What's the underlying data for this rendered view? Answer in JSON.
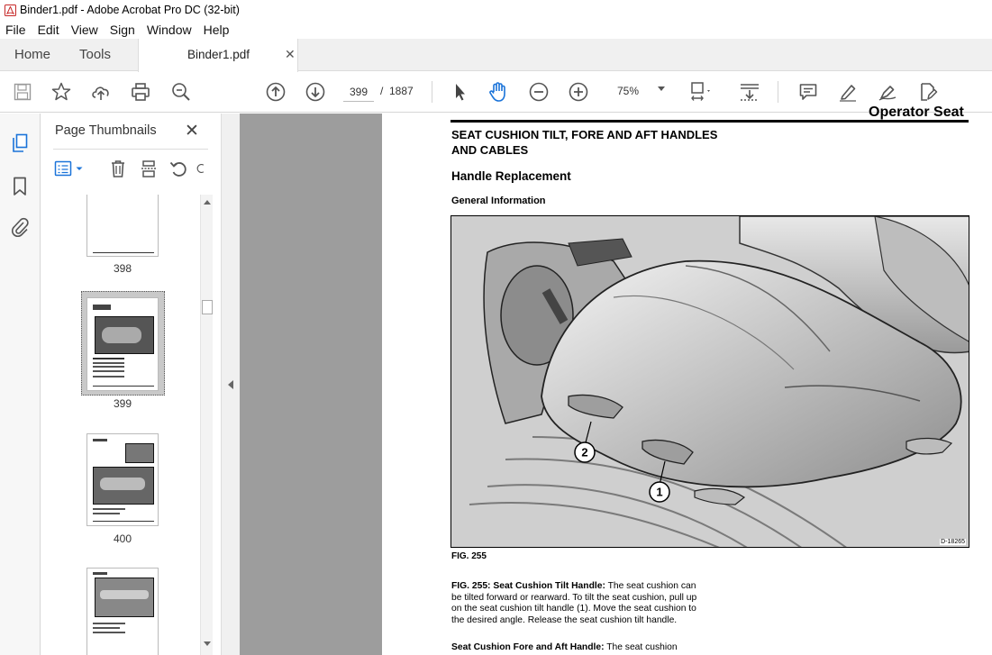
{
  "window": {
    "title": "Binder1.pdf - Adobe Acrobat Pro DC (32-bit)"
  },
  "menu": [
    "File",
    "Edit",
    "View",
    "Sign",
    "Window",
    "Help"
  ],
  "tabs": {
    "home": "Home",
    "tools": "Tools",
    "document": "Binder1.pdf"
  },
  "toolbar": {
    "current_page": "399",
    "page_separator": "/",
    "total_pages": "1887",
    "zoom": "75%"
  },
  "thumbnails_panel": {
    "title": "Page Thumbnails",
    "pages": [
      {
        "label": "398"
      },
      {
        "label": "399",
        "selected": true
      },
      {
        "label": "400"
      },
      {
        "label": ""
      }
    ]
  },
  "document": {
    "header": "Operator Seat",
    "title": "SEAT CUSHION TILT, FORE AND AFT HANDLES AND CABLES",
    "heading": "Handle Replacement",
    "subheading": "General Information",
    "figure_id": "D-18265",
    "callout_1": "1",
    "callout_2": "2",
    "figure_label": "FIG. 255",
    "para1_lead": "FIG. 255:  Seat Cushion Tilt Handle:",
    "para1_body": " The seat cushion can be tilted forward or rearward. To tilt the seat cushion, pull up on the seat cushion tilt handle (1). Move the seat cushion to the desired angle. Release the seat cushion tilt handle.",
    "para2_lead": "Seat Cushion Fore and Aft Handle:",
    "para2_body": " The seat cushion"
  },
  "icons": {
    "app": "acrobat-icon",
    "save": "save-icon",
    "bookmark": "star-icon",
    "upload": "upload-icon",
    "print": "print-icon",
    "search": "search-zoom-icon",
    "prev_page": "arrow-up-circle-icon",
    "next_page": "arrow-down-circle-icon",
    "select": "pointer-icon",
    "hand": "hand-icon",
    "zoom_out": "zoom-out-icon",
    "zoom_in": "zoom-in-icon",
    "fit": "fit-page-icon",
    "scroll_mode": "scroll-mode-icon",
    "comment": "comment-icon",
    "highlight": "highlight-icon",
    "draw": "draw-icon",
    "stamp": "stamp-icon"
  },
  "colors": {
    "acrobat_red": "#d21f1f",
    "doc_gray": "#9d9d9d",
    "icon_gray": "#555555"
  }
}
